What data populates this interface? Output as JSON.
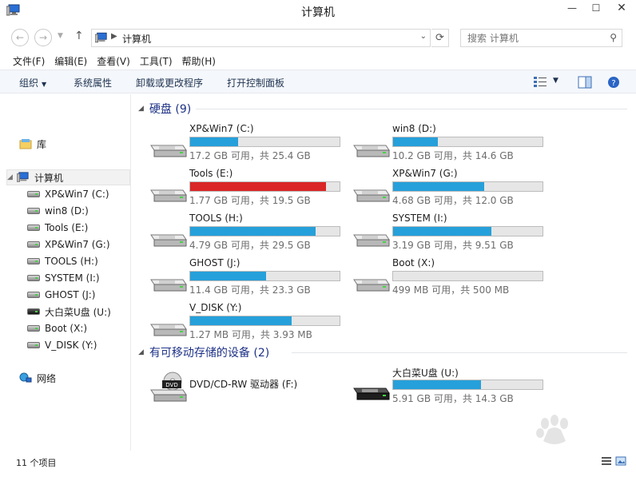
{
  "window": {
    "title": "计算机",
    "min_label": "—",
    "max_label": "☐",
    "close_label": "✕"
  },
  "address": {
    "path": "计算机",
    "search_placeholder": "搜索 计算机"
  },
  "menu": [
    "文件(F)",
    "编辑(E)",
    "查看(V)",
    "工具(T)",
    "帮助(H)"
  ],
  "commands": {
    "organize": "组织",
    "system_properties": "系统属性",
    "uninstall": "卸载或更改程序",
    "control_panel": "打开控制面板"
  },
  "nav": {
    "library": "库",
    "computer": "计算机",
    "drives": [
      "XP&Win7 (C:)",
      "win8 (D:)",
      "Tools (E:)",
      "XP&Win7 (G:)",
      "TOOLS (H:)",
      "SYSTEM (I:)",
      "GHOST (J:)",
      "大白菜U盘 (U:)",
      "Boot (X:)",
      "V_DISK (Y:)"
    ],
    "network": "网络"
  },
  "groups": {
    "hdd": {
      "title": "硬盘 (9)"
    },
    "removable": {
      "title": "有可移动存储的设备 (2)"
    }
  },
  "drives": [
    {
      "name": "XP&Win7 (C:)",
      "free": "17.2 GB 可用，共 25.4 GB",
      "used_fraction": 0.32,
      "warning": false
    },
    {
      "name": "win8 (D:)",
      "free": "10.2 GB 可用，共 14.6 GB",
      "used_fraction": 0.3,
      "warning": false
    },
    {
      "name": "Tools (E:)",
      "free": "1.77 GB 可用，共 19.5 GB",
      "used_fraction": 0.91,
      "warning": true
    },
    {
      "name": "XP&Win7 (G:)",
      "free": "4.68 GB 可用，共 12.0 GB",
      "used_fraction": 0.61,
      "warning": false
    },
    {
      "name": "TOOLS (H:)",
      "free": "4.79 GB 可用，共 29.5 GB",
      "used_fraction": 0.84,
      "warning": false
    },
    {
      "name": "SYSTEM (I:)",
      "free": "3.19 GB 可用，共 9.51 GB",
      "used_fraction": 0.66,
      "warning": false
    },
    {
      "name": "GHOST (J:)",
      "free": "11.4 GB 可用，共 23.3 GB",
      "used_fraction": 0.51,
      "warning": false
    },
    {
      "name": "Boot (X:)",
      "free": "499 MB 可用，共 500 MB",
      "used_fraction": 0.0,
      "warning": false
    },
    {
      "name": "V_DISK (Y:)",
      "free": "1.27 MB 可用，共 3.93 MB",
      "used_fraction": 0.68,
      "warning": false
    }
  ],
  "removable": [
    {
      "name": "DVD/CD-RW 驱动器 (F:)",
      "icon": "dvd-drive-icon"
    },
    {
      "name": "大白菜U盘 (U:)",
      "free": "5.91 GB 可用，共 14.3 GB",
      "used_fraction": 0.59,
      "warning": false,
      "icon": "usb-drive-icon"
    }
  ],
  "status": {
    "count": "11 个项目"
  },
  "colors": {
    "bar": "#26a0da",
    "bar_warning": "#da2626",
    "accent": "#1e3287"
  }
}
